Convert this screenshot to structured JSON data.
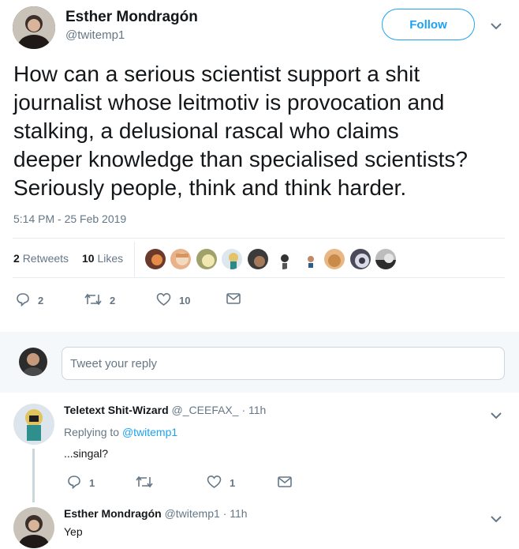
{
  "tweet": {
    "author_name": "Esther Mondragón",
    "author_handle": "@twitemp1",
    "follow_label": "Follow",
    "text_lines": [
      "How can a serious scientist support a shit",
      "journalist whose leitmotiv is provocation and",
      "stalking, a delusional rascal who claims",
      "deeper knowledge than specialised scientists?",
      "Seriously people, think and think harder."
    ],
    "timestamp": "5:14 PM - 25 Feb 2019",
    "retweets_count": "2",
    "retweets_label": "Retweets",
    "likes_count": "10",
    "likes_label": "Likes",
    "actions": {
      "reply_count": "2",
      "retweet_count": "2",
      "like_count": "10"
    }
  },
  "reply_box": {
    "placeholder": "Tweet your reply"
  },
  "replies": [
    {
      "author_name": "Teletext Shit-Wizard",
      "author_handle": "@_CEEFAX_",
      "time": "· 11h",
      "replying_to_label": "Replying to",
      "replying_to_handle": "@twitemp1",
      "text": "...singal?",
      "reply_count": "1",
      "retweet_count": "",
      "like_count": "1"
    },
    {
      "author_name": "Esther Mondragón",
      "author_handle": "@twitemp1",
      "time": "· 11h",
      "text": "Yep"
    }
  ],
  "colors": {
    "accent": "#1da1f2",
    "muted": "#657786",
    "text": "#14171a",
    "divider": "#e6ecf0",
    "reply_bg": "#f5f8fa"
  },
  "icons": [
    "chevron-down-icon",
    "reply-icon",
    "retweet-icon",
    "like-icon",
    "message-icon"
  ]
}
